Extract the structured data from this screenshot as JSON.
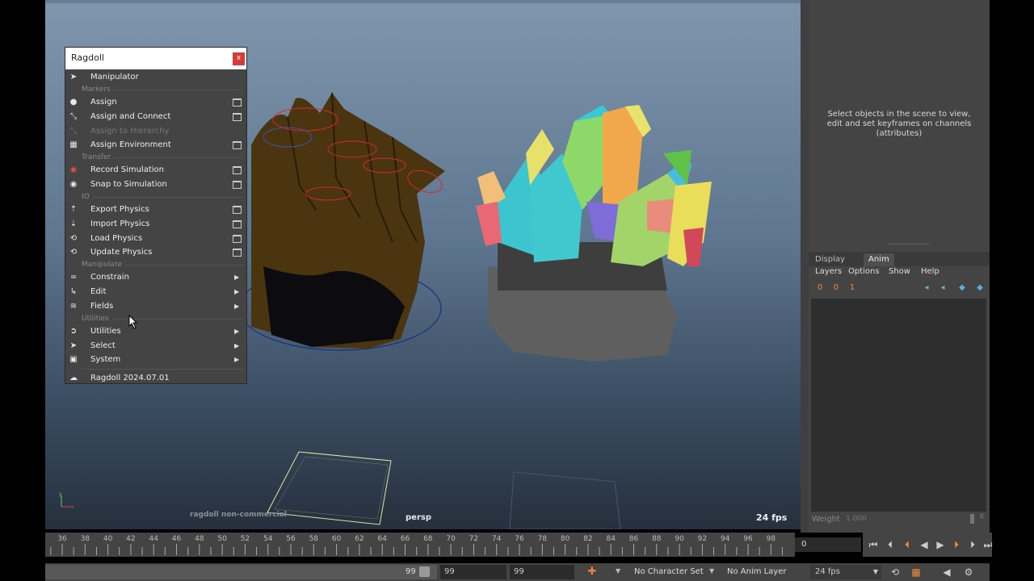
{
  "viewport": {
    "camera": "persp",
    "fps": "24 fps",
    "watermark": "ragdoll non-commercial"
  },
  "channel_box": {
    "hint": "Select objects in the scene to view, edit and set keyframes on channels (attributes)"
  },
  "layer_editor": {
    "tabs": [
      "Display",
      "Anim"
    ],
    "active_tab": "Anim",
    "menu": [
      "Layers",
      "Options",
      "Show",
      "Help"
    ],
    "weight_label": "Weight",
    "weight_value": "1.000",
    "weight_key": "K"
  },
  "time_slider": {
    "ticks": [
      "36",
      "38",
      "40",
      "42",
      "44",
      "46",
      "48",
      "50",
      "52",
      "54",
      "56",
      "58",
      "60",
      "62",
      "64",
      "66",
      "68",
      "70",
      "72",
      "74",
      "76",
      "78",
      "80",
      "82",
      "84",
      "86",
      "88",
      "90",
      "92",
      "94",
      "96",
      "98"
    ],
    "current_frame": "0"
  },
  "range_slider": {
    "range_end_display": "99",
    "start_field": "99",
    "end_field": "99",
    "character_set": "No Character Set",
    "anim_layer": "No Anim Layer",
    "fps": "24 fps"
  },
  "ragdoll_menu": {
    "title": "Ragdoll",
    "close": "x",
    "items": {
      "manipulator": "Manipulator",
      "markers_header": "Markers",
      "assign": "Assign",
      "assign_connect": "Assign and Connect",
      "assign_hierarchy": "Assign to Hierarchy",
      "assign_environment": "Assign Environment",
      "transfer_header": "Transfer",
      "record_simulation": "Record Simulation",
      "snap_to_simulation": "Snap to Simulation",
      "io_header": "IO",
      "export_physics": "Export Physics",
      "import_physics": "Import Physics",
      "load_physics": "Load Physics",
      "update_physics": "Update Physics",
      "manipulate_header": "Manipulate",
      "constrain": "Constrain",
      "edit": "Edit",
      "fields": "Fields",
      "utilities_header": "Utilities",
      "utilities": "Utilities",
      "select": "Select",
      "system": "System",
      "version": "Ragdoll 2024.07.01"
    }
  },
  "colors": {
    "viewport_top": "#7f96ad",
    "viewport_bottom": "#26303d",
    "panel": "#444444",
    "close_red": "#d93a3a",
    "hair_brown": "#4a3510"
  }
}
